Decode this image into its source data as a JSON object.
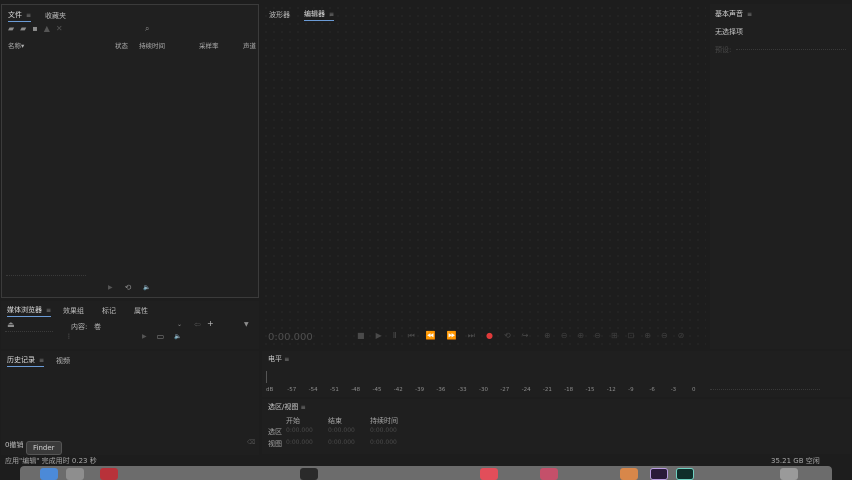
{
  "project_panel": {
    "tabs": [
      "文件",
      "收藏夹"
    ],
    "columns": [
      "名称",
      "状态",
      "持续时间",
      "采样率",
      "声道"
    ],
    "sort_indicator": "▾"
  },
  "source_tabs": {
    "tabs": [
      "媒体浏览器",
      "效果组",
      "标记",
      "属性"
    ],
    "content_label": "内容:",
    "content_value": "卷"
  },
  "history": {
    "tabs": [
      "历史记录",
      "视频"
    ],
    "undo_label": "0撤销",
    "tooltip": "Finder",
    "status_text": "应用\"编辑\" 完成用时 0.23 秒"
  },
  "editor": {
    "tabs": [
      "波形器",
      "编辑器"
    ],
    "timecode": "0:00.000"
  },
  "right_panel": {
    "title": "基本声音",
    "no_selection": "无选择项",
    "preset_label": "预设:",
    "disk_space": "35.21 GB 空闲"
  },
  "levels": {
    "title": "电平",
    "scale": [
      "dB",
      "-57",
      "-54",
      "-51",
      "-48",
      "-45",
      "-42",
      "-39",
      "-36",
      "-33",
      "-30",
      "-27",
      "-24",
      "-21",
      "-18",
      "-15",
      "-12",
      "-9",
      "-6",
      "-3",
      "0"
    ]
  },
  "selection_view": {
    "title": "选区/视图",
    "headers": [
      "开始",
      "结束",
      "持续时间"
    ],
    "rows": [
      {
        "label": "选区",
        "start": "0:00.000",
        "end": "0:00.000",
        "duration": "0:00.000"
      },
      {
        "label": "视图",
        "start": "0:00.000",
        "end": "0:00.000",
        "duration": "0:00.000"
      }
    ]
  },
  "icons": {
    "menu": "≡",
    "search": "⌕",
    "play": "▶",
    "loop": "⟲",
    "volume": "🔈",
    "record": "●",
    "stop": "■",
    "pause": "Ⅱ",
    "to_start": "⏮",
    "rewind": "⏪",
    "forward": "⏩",
    "to_end": "⏭",
    "filter": "▼",
    "add": "+",
    "cursor": "↖"
  },
  "colors": {
    "accent": "#6b9bd6",
    "record": "#e03a3a",
    "panel": "#232323",
    "bg": "#1d1d1d"
  }
}
